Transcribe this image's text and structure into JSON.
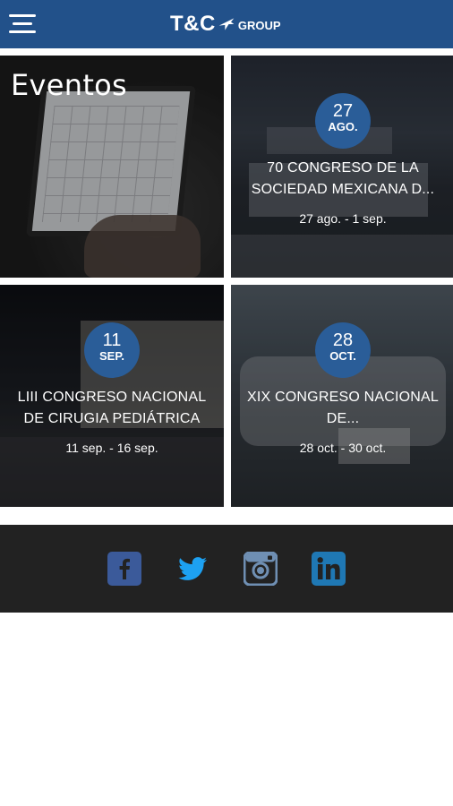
{
  "header": {
    "logo_main": "T&C",
    "logo_sub": "GROUP"
  },
  "section_title": "Eventos",
  "events": [
    {
      "day": "27",
      "month": "AGO.",
      "title": "70 CONGRESO DE LA SOCIEDAD MEXICANA D...",
      "range": "27 ago. - 1 sep."
    },
    {
      "day": "11",
      "month": "SEP.",
      "title": "LIII CONGRESO NACIONAL DE CIRUGIA PEDIÁTRICA",
      "range": "11 sep. - 16 sep."
    },
    {
      "day": "28",
      "month": "OCT.",
      "title": "XIX CONGRESO NACIONAL DE...",
      "range": "28 oct. - 30 oct."
    }
  ],
  "social": [
    {
      "name": "facebook-icon",
      "color": "#3b5a9a"
    },
    {
      "name": "twitter-icon",
      "color": "#1da1f2"
    },
    {
      "name": "instagram-icon",
      "color": "#6f8fb3"
    },
    {
      "name": "linkedin-icon",
      "color": "#1f78b4"
    }
  ],
  "colors": {
    "header_bg": "#22518a",
    "badge_bg": "#2a5d98",
    "footer_bg": "#222222"
  }
}
